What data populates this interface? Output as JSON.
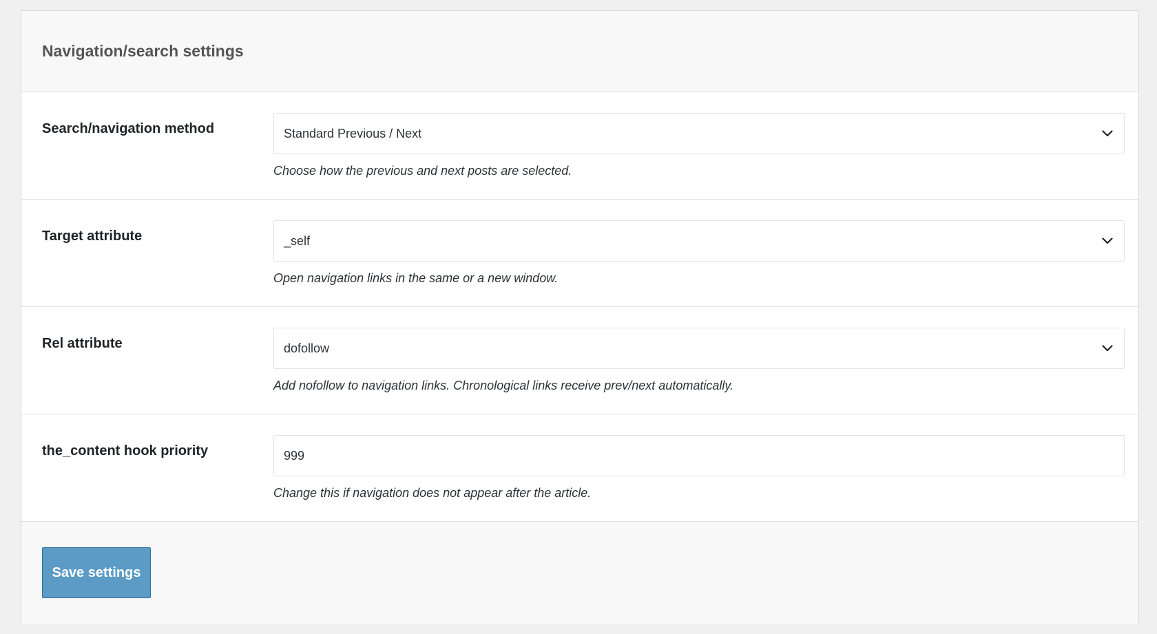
{
  "colors": {
    "page_background": "#f0f0f1",
    "header_background": "#f8f8f8",
    "save_button_background": "#5b9bc6",
    "save_button_border": "#2e6f9e",
    "title_text": "#555555"
  },
  "header": {
    "title": "Navigation/search settings"
  },
  "settings": [
    {
      "label": "Search/navigation method",
      "type": "select",
      "value": "Standard Previous / Next",
      "description": "Choose how the previous and next posts are selected.",
      "icon": "chevron-down-icon"
    },
    {
      "label": "Target attribute",
      "type": "select",
      "value": "_self",
      "description": "Open navigation links in the same or a new window.",
      "icon": "chevron-down-icon"
    },
    {
      "label": "Rel attribute",
      "type": "select",
      "value": "dofollow",
      "description": "Add nofollow to navigation links. Chronological links receive prev/next automatically.",
      "icon": "chevron-down-icon"
    },
    {
      "label": "the_content hook priority",
      "type": "text",
      "value": "999",
      "description": "Change this if navigation does not appear after the article."
    }
  ],
  "footer": {
    "save_label": "Save settings"
  }
}
